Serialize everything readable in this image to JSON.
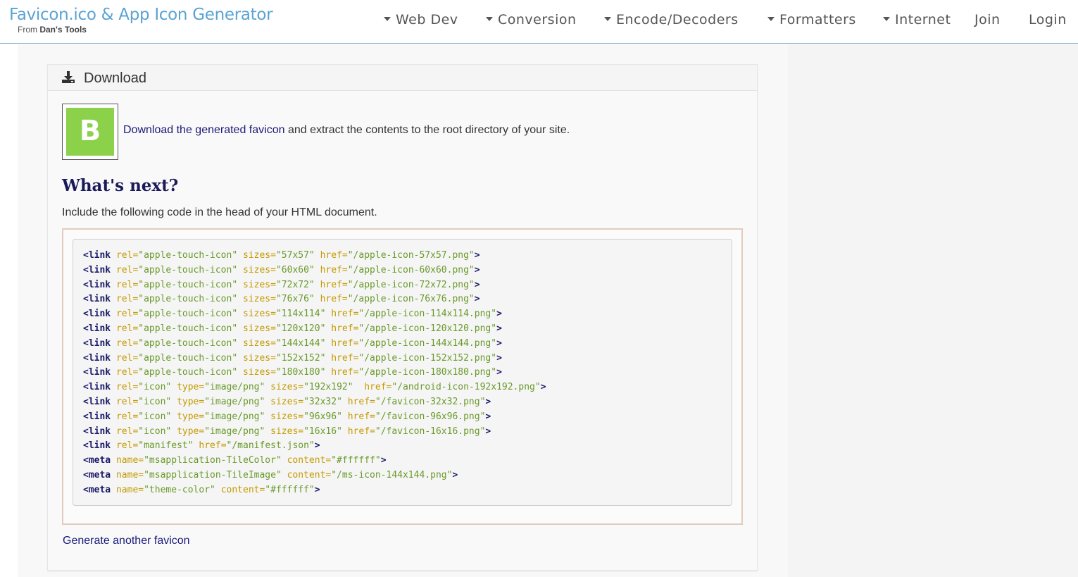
{
  "brand": {
    "title": "Favicon.ico & App Icon Generator",
    "sub_prefix": "From",
    "sub_name": "Dan's Tools"
  },
  "nav": [
    {
      "label": "Web Dev",
      "dropdown": true
    },
    {
      "label": "Conversion",
      "dropdown": true
    },
    {
      "label": "Encode/Decoders",
      "dropdown": true
    },
    {
      "label": "Formatters",
      "dropdown": true
    },
    {
      "label": "Internet",
      "dropdown": true
    },
    {
      "label": "Join",
      "dropdown": false
    },
    {
      "label": "Login",
      "dropdown": false
    }
  ],
  "panel": {
    "title": "Download",
    "icon": "download-icon",
    "favicon_letter": "B",
    "favicon_color": "#8bd14a",
    "download_link": "Download the generated favicon",
    "download_rest": " and extract the contents to the root directory of your site."
  },
  "next": {
    "heading": "What's next?",
    "intro": "Include the following code in the head of your HTML document."
  },
  "code_lines": [
    "<link rel=\"apple-touch-icon\" sizes=\"57x57\" href=\"/apple-icon-57x57.png\">",
    "<link rel=\"apple-touch-icon\" sizes=\"60x60\" href=\"/apple-icon-60x60.png\">",
    "<link rel=\"apple-touch-icon\" sizes=\"72x72\" href=\"/apple-icon-72x72.png\">",
    "<link rel=\"apple-touch-icon\" sizes=\"76x76\" href=\"/apple-icon-76x76.png\">",
    "<link rel=\"apple-touch-icon\" sizes=\"114x114\" href=\"/apple-icon-114x114.png\">",
    "<link rel=\"apple-touch-icon\" sizes=\"120x120\" href=\"/apple-icon-120x120.png\">",
    "<link rel=\"apple-touch-icon\" sizes=\"144x144\" href=\"/apple-icon-144x144.png\">",
    "<link rel=\"apple-touch-icon\" sizes=\"152x152\" href=\"/apple-icon-152x152.png\">",
    "<link rel=\"apple-touch-icon\" sizes=\"180x180\" href=\"/apple-icon-180x180.png\">",
    "<link rel=\"icon\" type=\"image/png\" sizes=\"192x192\"  href=\"/android-icon-192x192.png\">",
    "<link rel=\"icon\" type=\"image/png\" sizes=\"32x32\" href=\"/favicon-32x32.png\">",
    "<link rel=\"icon\" type=\"image/png\" sizes=\"96x96\" href=\"/favicon-96x96.png\">",
    "<link rel=\"icon\" type=\"image/png\" sizes=\"16x16\" href=\"/favicon-16x16.png\">",
    "<link rel=\"manifest\" href=\"/manifest.json\">",
    "<meta name=\"msapplication-TileColor\" content=\"#ffffff\">",
    "<meta name=\"msapplication-TileImage\" content=\"/ms-icon-144x144.png\">",
    "<meta name=\"theme-color\" content=\"#ffffff\">"
  ],
  "footer_link": "Generate another favicon",
  "colors": {
    "brand": "#5aa3d3",
    "link": "#1a1a7a",
    "code_tag": "#1a1a6a",
    "code_attr": "#c49a00",
    "code_value": "#6a9a2a"
  }
}
